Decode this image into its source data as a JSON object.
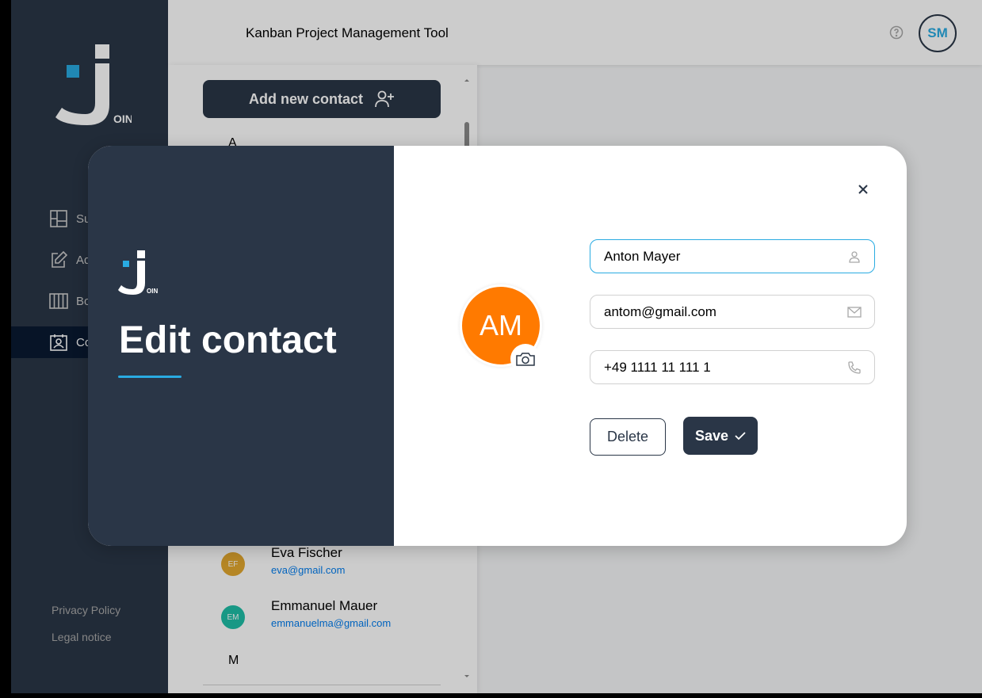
{
  "header": {
    "title": "Kanban Project Management Tool",
    "user_initials": "SM"
  },
  "sidebar": {
    "logo_text": "OIN",
    "items": [
      {
        "label": "Summary",
        "icon": "summary-icon",
        "active": false
      },
      {
        "label": "Add Task",
        "icon": "add-task-icon",
        "active": false
      },
      {
        "label": "Board",
        "icon": "board-icon",
        "active": false
      },
      {
        "label": "Contacts",
        "icon": "contacts-icon",
        "active": true
      }
    ],
    "footer": {
      "privacy": "Privacy Policy",
      "legal": "Legal notice"
    }
  },
  "contact_list": {
    "add_button_label": "Add new contact",
    "letter_a": "A",
    "letter_m": "M",
    "contacts": [
      {
        "initials": "EF",
        "name": "Eva Fischer",
        "email": "eva@gmail.com",
        "color": "#e3a82f"
      },
      {
        "initials": "EM",
        "name": "Emmanuel Mauer",
        "email": "emmanuelma@gmail.com",
        "color": "#1fbfa7"
      }
    ]
  },
  "modal": {
    "logo_text": "OIN",
    "title": "Edit contact",
    "avatar_initials": "AM",
    "avatar_color": "#ff7a00",
    "name_value": "Anton Mayer",
    "email_value": "antom@gmail.com",
    "phone_value": "+49 1111 11 111 1",
    "delete_label": "Delete",
    "save_label": "Save"
  }
}
